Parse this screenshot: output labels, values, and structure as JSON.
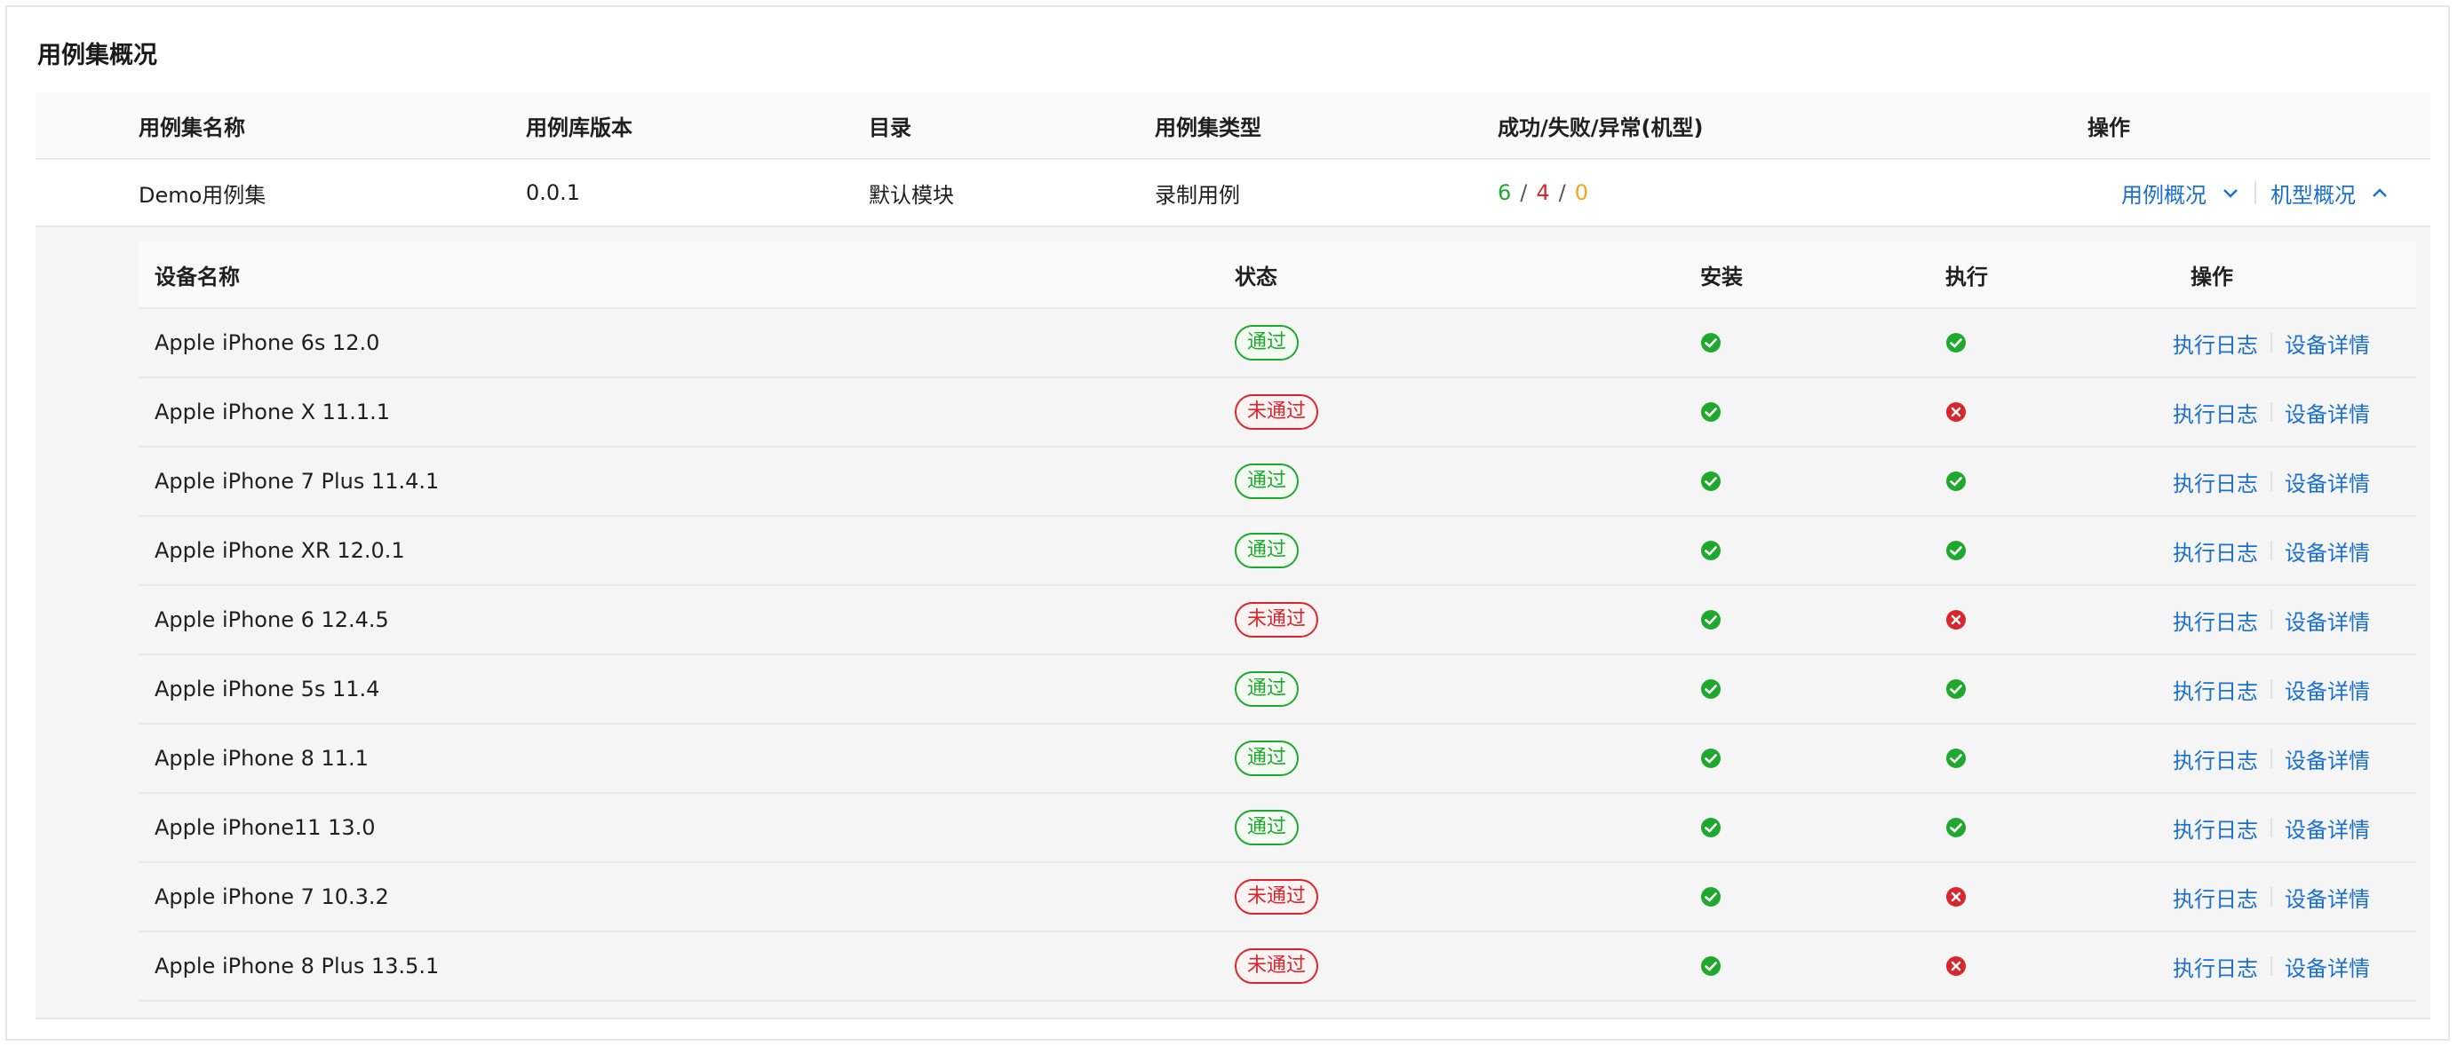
{
  "title": "用例集概况",
  "colors": {
    "success": "#1fa82e",
    "fail": "#d9262c",
    "error": "#f0a81a",
    "link": "#1a6fce"
  },
  "outer": {
    "headers": [
      "用例集名称",
      "用例库版本",
      "目录",
      "用例集类型",
      "成功/失败/异常(机型)",
      "操作"
    ],
    "row": {
      "name": "Demo用例集",
      "version": "0.0.1",
      "directory": "默认模块",
      "type": "录制用例",
      "success": "6",
      "fail": "4",
      "error": "0",
      "slash": "/",
      "action_case": "用例概况",
      "action_case_icon": "chevron-down-icon",
      "action_device": "机型概况",
      "action_device_icon": "chevron-up-icon"
    }
  },
  "inner": {
    "headers": [
      "设备名称",
      "状态",
      "安装",
      "执行",
      "操作"
    ],
    "action_log": "执行日志",
    "action_detail": "设备详情",
    "rows": [
      {
        "device": "Apple iPhone 6s 12.0",
        "status": "通过",
        "pass": true,
        "install": true,
        "exec": true
      },
      {
        "device": "Apple iPhone X 11.1.1",
        "status": "未通过",
        "pass": false,
        "install": true,
        "exec": false
      },
      {
        "device": "Apple iPhone 7 Plus 11.4.1",
        "status": "通过",
        "pass": true,
        "install": true,
        "exec": true
      },
      {
        "device": "Apple iPhone XR 12.0.1",
        "status": "通过",
        "pass": true,
        "install": true,
        "exec": true
      },
      {
        "device": "Apple iPhone 6 12.4.5",
        "status": "未通过",
        "pass": false,
        "install": true,
        "exec": false
      },
      {
        "device": "Apple iPhone 5s 11.4",
        "status": "通过",
        "pass": true,
        "install": true,
        "exec": true
      },
      {
        "device": "Apple iPhone 8 11.1",
        "status": "通过",
        "pass": true,
        "install": true,
        "exec": true
      },
      {
        "device": "Apple iPhone11 13.0",
        "status": "通过",
        "pass": true,
        "install": true,
        "exec": true
      },
      {
        "device": "Apple iPhone 7 10.3.2",
        "status": "未通过",
        "pass": false,
        "install": true,
        "exec": false
      },
      {
        "device": "Apple iPhone 8 Plus 13.5.1",
        "status": "未通过",
        "pass": false,
        "install": true,
        "exec": false
      }
    ]
  }
}
